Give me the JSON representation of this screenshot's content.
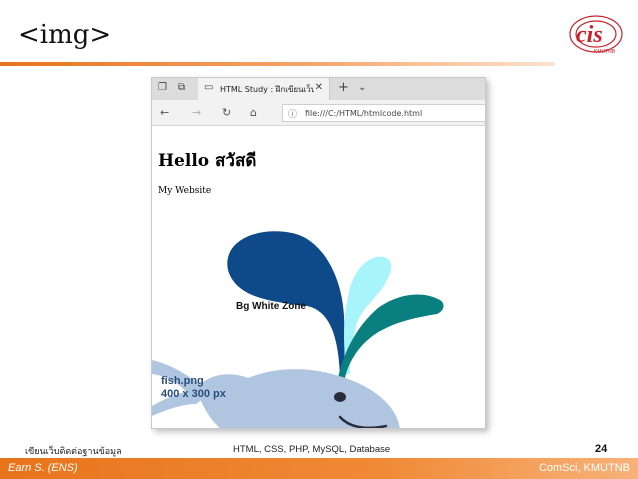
{
  "slide": {
    "title": "<img>",
    "logo_text": "cis",
    "logo_subtext": "KMUTNB"
  },
  "browser": {
    "tab_title": "HTML Study : ฝึกเขียนเว็บ",
    "url": "file:///C:/HTML/htmlcode.html",
    "icons": [
      "tab-manager-icon",
      "set-aside-icon",
      "page-icon",
      "close-icon",
      "new-tab-icon",
      "chevron-down-icon",
      "back-icon",
      "forward-icon",
      "refresh-icon",
      "home-icon",
      "info-icon"
    ]
  },
  "page": {
    "heading": "Hello สวัสดี",
    "paragraph": "My Website",
    "image_label": "Bg White Zone",
    "image_filename": "fish.png",
    "image_size": "400 x 300 px"
  },
  "footer": {
    "left_text": "เขียนเว็บติดต่อฐานข้อมูล",
    "center_text": "HTML, CSS, PHP, MySQL, Database",
    "page_number": "24",
    "author": "Earn S. (ENS)",
    "org": "ComSci, KMUTNB"
  },
  "colors": {
    "accent": "#e8741c",
    "whale_body": "#b0c6e0",
    "spout_dark": "#0e4a8a",
    "spout_light": "#a8f4fb",
    "spout_teal": "#0a7f80",
    "logo_red": "#c8232c"
  }
}
